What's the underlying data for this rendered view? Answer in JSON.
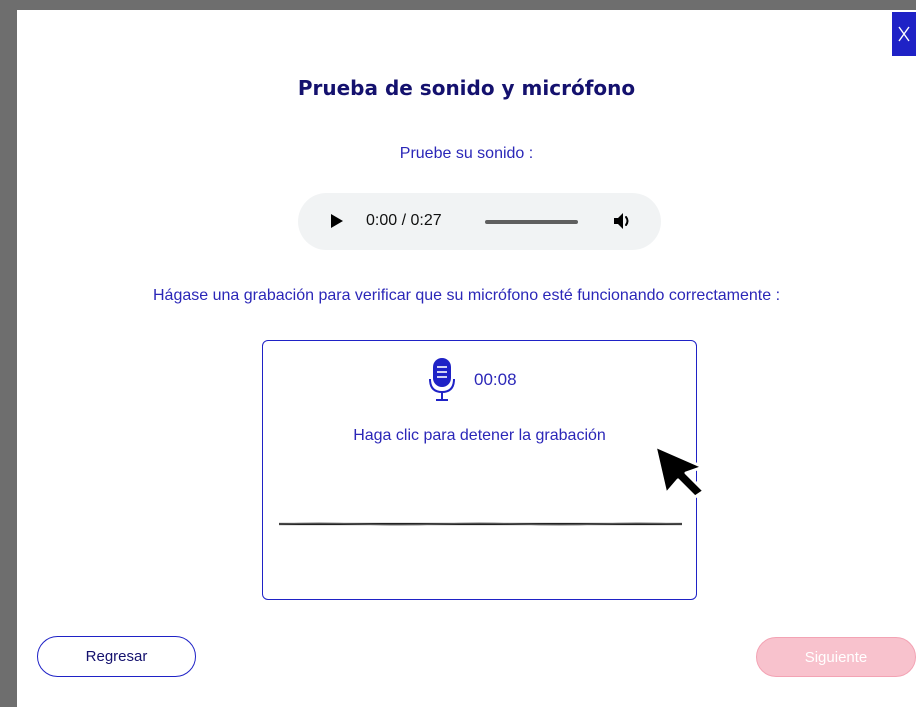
{
  "dialog": {
    "title": "Prueba de sonido y micrófono",
    "close_icon": "close-x-icon"
  },
  "sound_test": {
    "label": "Pruebe su sonido :",
    "player": {
      "time": "0:00 / 0:27",
      "progress": 0,
      "play_icon": "play-icon",
      "volume_icon": "volume-icon"
    }
  },
  "mic_test": {
    "instruction": "Hágase una grabación para verificar que su micrófono esté funcionando correctamente :",
    "timer": "00:08",
    "action_text": "Haga clic para detener la grabación",
    "mic_icon": "microphone-icon"
  },
  "buttons": {
    "back": "Regresar",
    "next": "Siguiente",
    "next_enabled": false
  },
  "colors": {
    "primary": "#1f22c6",
    "title": "#14116e",
    "text": "#2b27b8",
    "next_disabled": "#f8c2cd"
  }
}
